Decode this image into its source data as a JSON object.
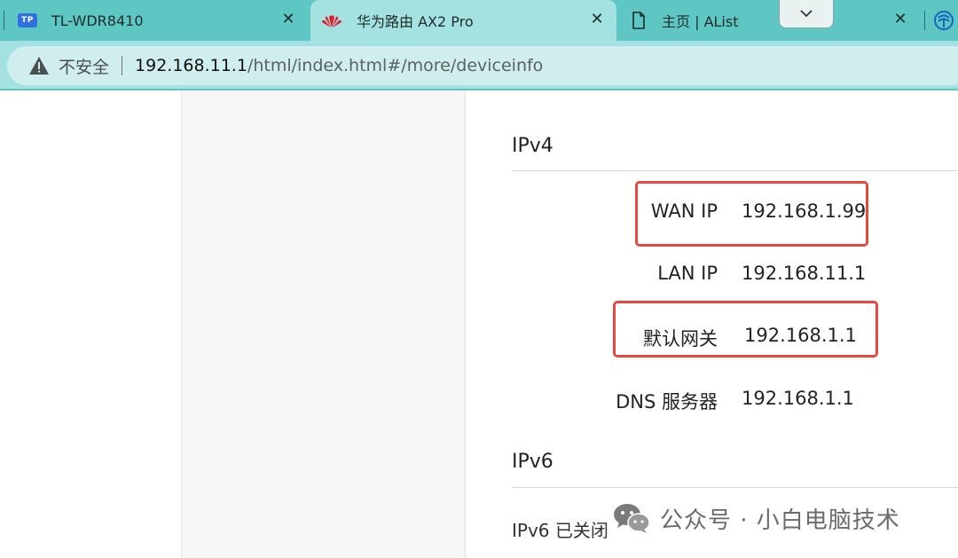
{
  "tabs": [
    {
      "title": "TL-WDR8410",
      "favicon": "tp-link-icon"
    },
    {
      "title": "华为路由 AX2 Pro",
      "favicon": "huawei-icon"
    },
    {
      "title": "主页 | AList",
      "favicon": "document-icon"
    }
  ],
  "tp_badge": "TP",
  "close_glyph": "✕",
  "address_bar": {
    "security_label": "不安全",
    "url_host": "192.168.11.1",
    "url_path": "/html/index.html#/more/deviceinfo"
  },
  "ipv4": {
    "title": "IPv4",
    "rows": [
      {
        "label": "WAN IP",
        "value": "192.168.1.99"
      },
      {
        "label": "LAN IP",
        "value": "192.168.11.1"
      },
      {
        "label": "默认网关",
        "value": "192.168.1.1"
      },
      {
        "label": "DNS 服务器",
        "value": "192.168.1.1"
      }
    ]
  },
  "ipv6": {
    "title": "IPv6",
    "status": "IPv6 已关闭"
  },
  "watermark": {
    "text": "公众号 · 小白电脑技术",
    "icon": "wechat-icon"
  },
  "colors": {
    "tab_strip": "#5fc7c3",
    "active_tab": "#a4e2e1",
    "highlight_box": "#e8493f",
    "huawei_red": "#e0202c"
  }
}
